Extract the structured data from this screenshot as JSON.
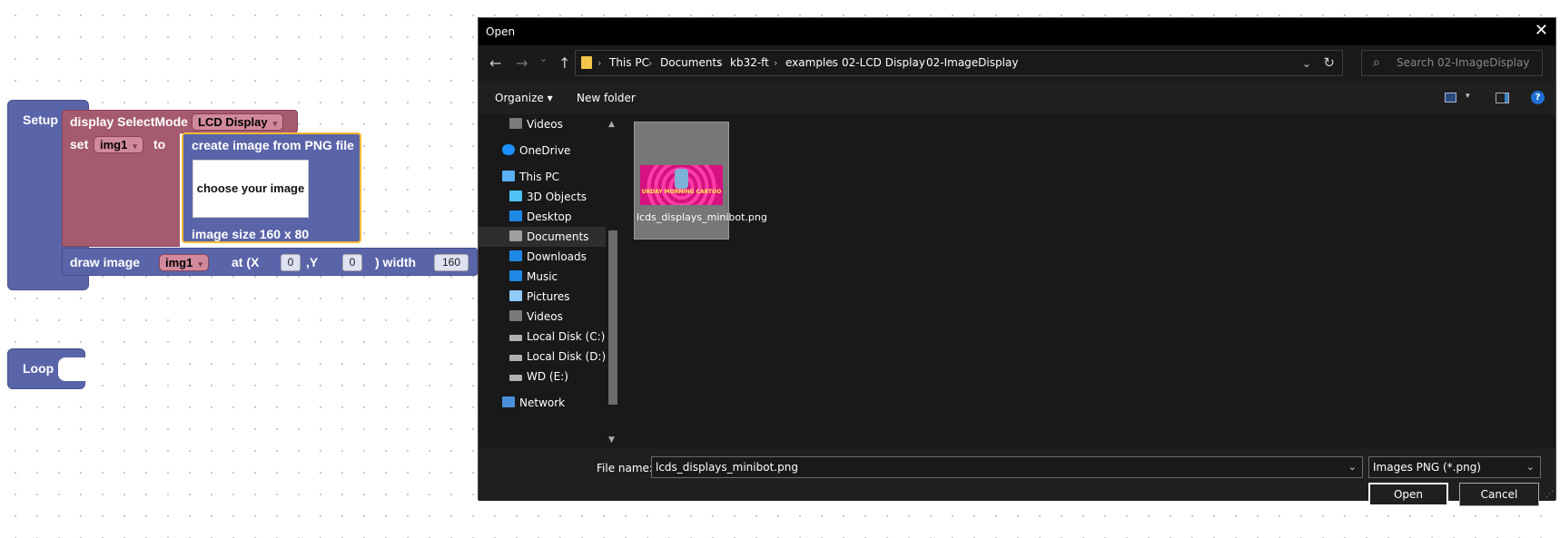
{
  "blocks": {
    "setup_label": "Setup",
    "loop_label": "Loop",
    "display_select_label": "display SelectMode",
    "display_mode_value": "LCD Display",
    "set_label": "set",
    "set_var": "img1",
    "to_label": "to",
    "png_block_title": "create image from PNG file",
    "choose_image_label": "choose your image",
    "image_size_label": "image size 160 x 80",
    "draw_image_label": "draw image",
    "draw_var": "img1",
    "at_x_label": "at (X",
    "x_value": "0",
    "y_label": ",Y",
    "y_value": "0",
    "width_label": ") width",
    "width_value": "160"
  },
  "dialog": {
    "title": "Open",
    "close_glyph": "✕",
    "nav": {
      "back": "←",
      "forward": "→",
      "recent": "⌄",
      "up": "↑"
    },
    "breadcrumb": [
      "This PC",
      "Documents",
      "kb32-ft",
      "examples",
      "02-LCD Display",
      "02-ImageDisplay"
    ],
    "crumb_sep": "›",
    "search_placeholder": "Search 02-ImageDisplay",
    "toolbar": {
      "organize": "Organize ▾",
      "new_folder": "New folder",
      "help": "?"
    },
    "nav_items": [
      {
        "label": "Videos",
        "icon": "videos-icon",
        "color": "#7a7a7a"
      },
      {
        "label": "OneDrive",
        "icon": "onedrive-icon",
        "color": "#1e90ff"
      },
      {
        "label": "This PC",
        "icon": "pc-icon",
        "color": "#5ab0f0"
      },
      {
        "label": "3D Objects",
        "icon": "3d-objects-icon",
        "color": "#4fc3f7"
      },
      {
        "label": "Desktop",
        "icon": "desktop-icon",
        "color": "#1e88e5"
      },
      {
        "label": "Documents",
        "icon": "documents-icon",
        "color": "#9e9e9e"
      },
      {
        "label": "Downloads",
        "icon": "downloads-icon",
        "color": "#1e88e5"
      },
      {
        "label": "Music",
        "icon": "music-icon",
        "color": "#1e88e5"
      },
      {
        "label": "Pictures",
        "icon": "pictures-icon",
        "color": "#90caf9"
      },
      {
        "label": "Videos",
        "icon": "videos-icon",
        "color": "#7a7a7a"
      },
      {
        "label": "Local Disk (C:)",
        "icon": "drive-icon",
        "color": "#b0b0b0"
      },
      {
        "label": "Local Disk (D:)",
        "icon": "drive-icon",
        "color": "#b0b0b0"
      },
      {
        "label": "WD (E:)",
        "icon": "drive-icon",
        "color": "#b0b0b0"
      },
      {
        "label": "Network",
        "icon": "network-icon",
        "color": "#4a90d9"
      }
    ],
    "file": {
      "name": "lcds_displays_minibot.png",
      "thumb_text": "URDAY MORNING CARTOO"
    },
    "filename_label": "File name:",
    "filename_value": "lcds_displays_minibot.png",
    "filetype_value": "Images PNG (*.png)",
    "open_button": "Open",
    "cancel_button": "Cancel"
  }
}
